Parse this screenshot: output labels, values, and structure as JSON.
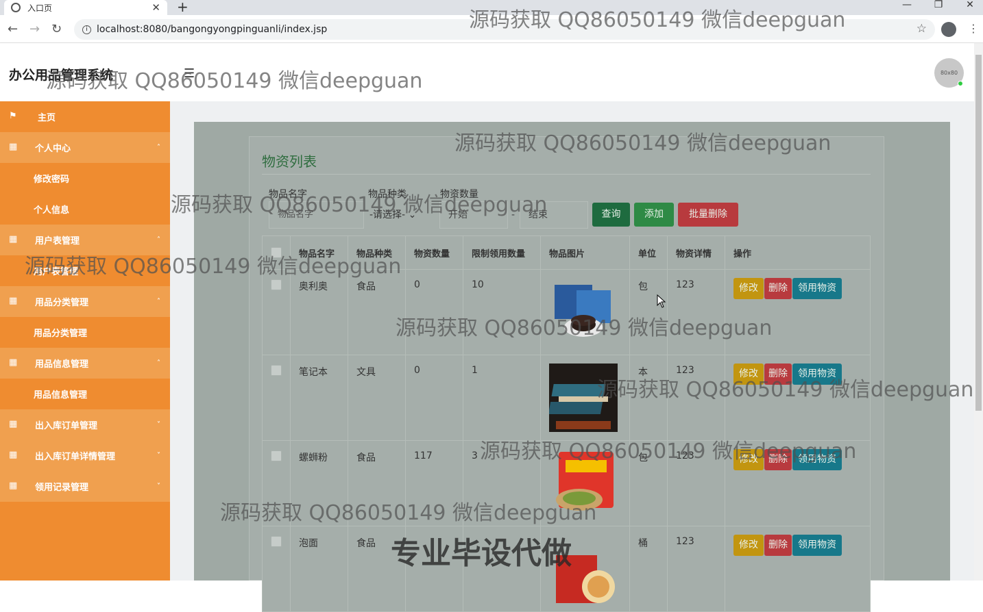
{
  "browser": {
    "tab_title": "入口页",
    "url": "localhost:8080/bangongyongpinguanli/index.jsp"
  },
  "header": {
    "title": "办公用品管理系统",
    "avatar_text": "80x80"
  },
  "sidebar": {
    "items": [
      {
        "label": "主页",
        "kind": "top",
        "icon": "flag-icon"
      },
      {
        "label": "个人中心",
        "kind": "top",
        "icon": "grid-icon",
        "expanded": true
      },
      {
        "label": "修改密码",
        "kind": "sub"
      },
      {
        "label": "个人信息",
        "kind": "sub"
      },
      {
        "label": "用户表管理",
        "kind": "top",
        "icon": "grid-icon",
        "expanded": true
      },
      {
        "label": "用户表管理",
        "kind": "sub"
      },
      {
        "label": "用品分类管理",
        "kind": "top",
        "icon": "grid-icon",
        "expanded": true
      },
      {
        "label": "用品分类管理",
        "kind": "sub"
      },
      {
        "label": "用品信息管理",
        "kind": "top",
        "icon": "grid-icon",
        "expanded": true
      },
      {
        "label": "用品信息管理",
        "kind": "sub"
      },
      {
        "label": "出入库订单管理",
        "kind": "top",
        "icon": "grid-icon",
        "expanded": false
      },
      {
        "label": "出入库订单详情管理",
        "kind": "top",
        "icon": "grid-icon",
        "expanded": false
      },
      {
        "label": "领用记录管理",
        "kind": "top",
        "icon": "grid-icon",
        "expanded": false
      }
    ]
  },
  "main": {
    "panel_title": "物资列表",
    "filters": {
      "name_label": "物品名字",
      "name_placeholder": "物品名字",
      "type_label": "物品种类",
      "type_value": "-请选择-",
      "qty_label": "物资数量",
      "start_placeholder": "开始",
      "dash": "-",
      "end_placeholder": "结束"
    },
    "buttons": {
      "search": "查询",
      "add": "添加",
      "batch_delete": "批量删除"
    },
    "table": {
      "headers": [
        "物品名字",
        "物品种类",
        "物资数量",
        "限制领用数量",
        "物品图片",
        "单位",
        "物资详情",
        "操作"
      ],
      "rows": [
        {
          "name": "奥利奥",
          "type": "食品",
          "qty": "0",
          "limit": "10",
          "unit": "包",
          "detail": "123"
        },
        {
          "name": "笔记本",
          "type": "文具",
          "qty": "0",
          "limit": "1",
          "unit": "本",
          "detail": "123"
        },
        {
          "name": "螺蛳粉",
          "type": "食品",
          "qty": "117",
          "limit": "3",
          "unit": "包",
          "detail": "123"
        },
        {
          "name": "泡面",
          "type": "食品",
          "qty": "",
          "limit": "",
          "unit": "桶",
          "detail": "123"
        }
      ],
      "actions": {
        "edit": "修改",
        "delete": "删除",
        "take": "领用物资"
      }
    }
  },
  "watermarks": {
    "qq": "源码获取 QQ86050149 微信deepguan",
    "promo": "专业毕设代做"
  }
}
